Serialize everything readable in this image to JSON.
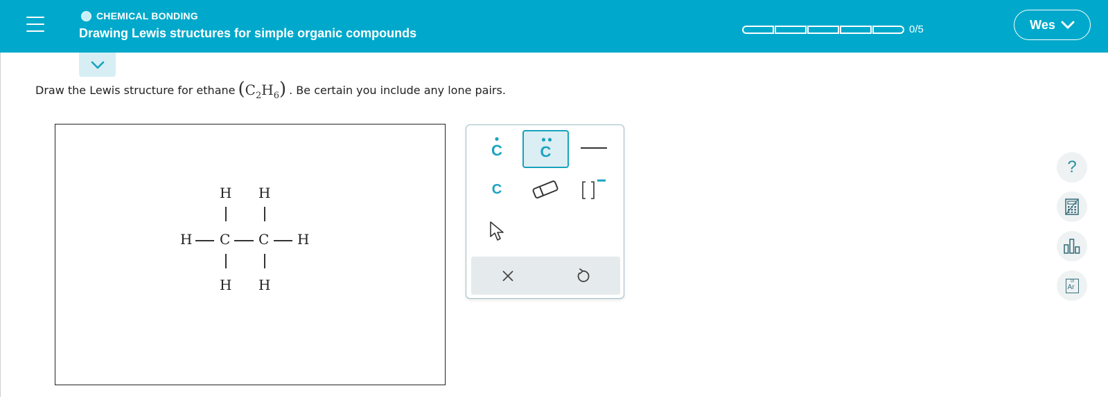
{
  "header": {
    "topic": "CHEMICAL BONDING",
    "title": "Drawing Lewis structures for simple organic compounds",
    "progress_text": "0/5",
    "progress": {
      "completed": 0,
      "total": 5
    },
    "user_name": "Wes",
    "colors": {
      "bar": "#00a9cb",
      "accent": "#16a2bd"
    }
  },
  "question": {
    "text_before": "Draw the Lewis structure for ethane",
    "formula": {
      "open": "(",
      "c": "C",
      "c_sub": "2",
      "h": "H",
      "h_sub": "6",
      "close": ")"
    },
    "text_after": ". Be certain you include any lone pairs."
  },
  "canvas": {
    "atoms": {
      "h_top_left": "H",
      "h_top_right": "H",
      "h_left": "H",
      "c_left": "C",
      "c_right": "C",
      "h_right": "H",
      "h_bottom_left": "H",
      "h_bottom_right": "H"
    }
  },
  "toolbox": {
    "tools": [
      {
        "name": "atom-with-radical",
        "label": "C",
        "icon": "single-dot"
      },
      {
        "name": "atom-with-lone-pair",
        "label": "C",
        "icon": "double-dot",
        "selected": true
      },
      {
        "name": "bond",
        "icon": "line"
      },
      {
        "name": "atom",
        "label": "C"
      },
      {
        "name": "eraser",
        "icon": "eraser-icon"
      },
      {
        "name": "bracket-charge",
        "icon": "bracket-icon"
      },
      {
        "name": "select",
        "icon": "cursor-icon"
      }
    ],
    "actions": [
      {
        "name": "clear",
        "icon": "close-icon"
      },
      {
        "name": "undo",
        "icon": "undo-icon"
      }
    ]
  },
  "side_tools": [
    {
      "name": "help",
      "icon": "question-icon",
      "label": "?"
    },
    {
      "name": "calculator",
      "icon": "calculator-icon"
    },
    {
      "name": "data",
      "icon": "bar-chart-icon"
    },
    {
      "name": "periodic-table",
      "icon": "periodic-table-icon",
      "label": "Ar",
      "number": "18"
    }
  ]
}
